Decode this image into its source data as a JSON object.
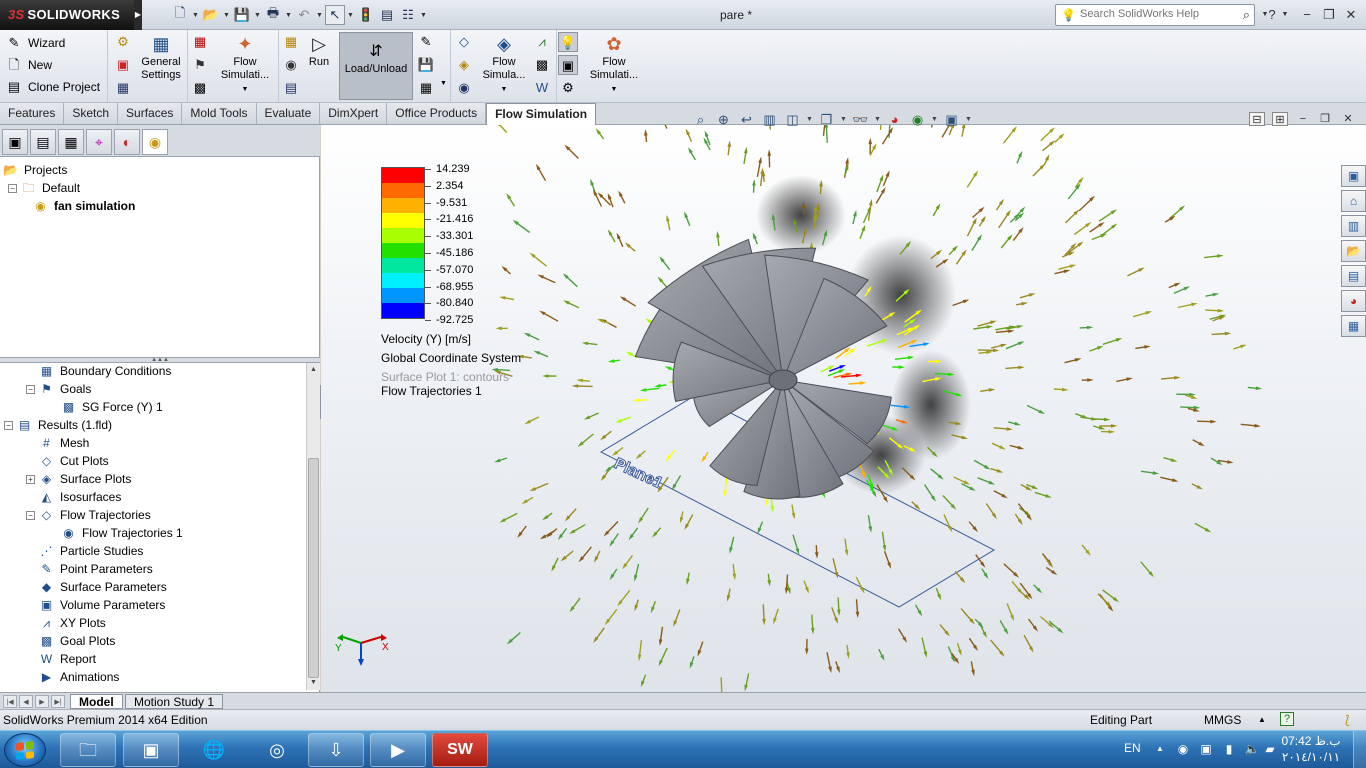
{
  "app": {
    "logo_ds": "3S",
    "logo_text": "SOLIDWORKS",
    "doc_title": "pare *",
    "help_search_placeholder": "Search SolidWorks Help"
  },
  "command_manager": {
    "wizard": "Wizard",
    "new": "New",
    "clone_project": "Clone Project",
    "general_settings_l1": "General",
    "general_settings_l2": "Settings",
    "flow_sim_1_l1": "Flow",
    "flow_sim_1_l2": "Simulati...",
    "run": "Run",
    "load_unload": "Load/Unload",
    "flow_sim_2_l1": "Flow",
    "flow_sim_2_l2": "Simula...",
    "flow_sim_3_l1": "Flow",
    "flow_sim_3_l2": "Simulati..."
  },
  "tabs": [
    "Features",
    "Sketch",
    "Surfaces",
    "Mold Tools",
    "Evaluate",
    "DimXpert",
    "Office Products",
    "Flow Simulation"
  ],
  "active_tab": "Flow Simulation",
  "projects_tree": {
    "root": "Projects",
    "default": "Default",
    "active": "fan simulation"
  },
  "analysis_tree": [
    {
      "label": "Boundary Conditions",
      "indent": 2,
      "icon": "boundary-conditions-icon",
      "glyph": "▦",
      "toggle": ""
    },
    {
      "label": "Goals",
      "indent": 2,
      "icon": "goals-icon",
      "glyph": "⚑",
      "toggle": "−"
    },
    {
      "label": "SG Force (Y) 1",
      "indent": 3,
      "icon": "surface-goal-icon",
      "glyph": "▩",
      "toggle": ""
    },
    {
      "label": "Results (1.fld)",
      "indent": 1,
      "icon": "results-icon",
      "glyph": "▤",
      "toggle": "−"
    },
    {
      "label": "Mesh",
      "indent": 2,
      "icon": "mesh-icon",
      "glyph": "#",
      "toggle": ""
    },
    {
      "label": "Cut Plots",
      "indent": 2,
      "icon": "cut-plots-icon",
      "glyph": "◇",
      "toggle": ""
    },
    {
      "label": "Surface Plots",
      "indent": 2,
      "icon": "surface-plots-icon",
      "glyph": "◈",
      "toggle": "+"
    },
    {
      "label": "Isosurfaces",
      "indent": 2,
      "icon": "isosurfaces-icon",
      "glyph": "◭",
      "toggle": ""
    },
    {
      "label": "Flow Trajectories",
      "indent": 2,
      "icon": "flow-trajectories-icon",
      "glyph": "◇",
      "toggle": "−"
    },
    {
      "label": "Flow Trajectories 1",
      "indent": 3,
      "icon": "flow-trajectory-item-icon",
      "glyph": "◉",
      "toggle": ""
    },
    {
      "label": "Particle Studies",
      "indent": 2,
      "icon": "particle-studies-icon",
      "glyph": "⋰",
      "toggle": ""
    },
    {
      "label": "Point Parameters",
      "indent": 2,
      "icon": "point-parameters-icon",
      "glyph": "✎",
      "toggle": ""
    },
    {
      "label": "Surface Parameters",
      "indent": 2,
      "icon": "surface-parameters-icon",
      "glyph": "◆",
      "toggle": ""
    },
    {
      "label": "Volume Parameters",
      "indent": 2,
      "icon": "volume-parameters-icon",
      "glyph": "▣",
      "toggle": ""
    },
    {
      "label": "XY Plots",
      "indent": 2,
      "icon": "xy-plots-icon",
      "glyph": "⩘",
      "toggle": ""
    },
    {
      "label": "Goal Plots",
      "indent": 2,
      "icon": "goal-plots-icon",
      "glyph": "▩",
      "toggle": ""
    },
    {
      "label": "Report",
      "indent": 2,
      "icon": "report-icon",
      "glyph": "W",
      "toggle": ""
    },
    {
      "label": "Animations",
      "indent": 2,
      "icon": "animations-icon",
      "glyph": "▶",
      "toggle": ""
    }
  ],
  "legend": {
    "values": [
      "14.239",
      "2.354",
      "-9.531",
      "-21.416",
      "-33.301",
      "-45.186",
      "-57.070",
      "-68.955",
      "-80.840",
      "-92.725"
    ],
    "colors": [
      "#ff0000",
      "#ff6a00",
      "#ffb000",
      "#ffff00",
      "#a8ff00",
      "#22e000",
      "#00e8a0",
      "#00f0ff",
      "#0096ff",
      "#0000ff"
    ],
    "title": "Velocity (Y) [m/s]",
    "coord_system": "Global Coordinate System",
    "surface_plot": "Surface Plot 1: contours",
    "flow_traj": "Flow Trajectories 1"
  },
  "viewport": {
    "plane_label": "Plane1",
    "triad_x": "X",
    "triad_y": "Y",
    "fan_color": "#8c8f96"
  },
  "model_tabs": [
    "Model",
    "Motion Study 1"
  ],
  "status": {
    "edition": "SolidWorks Premium 2014 x64 Edition",
    "editing": "Editing Part",
    "units": "MMGS"
  },
  "taskbar": {
    "lang": "EN",
    "time": "07:42 ب.ظ",
    "date": "٢٠١٤/١٠/١١"
  }
}
